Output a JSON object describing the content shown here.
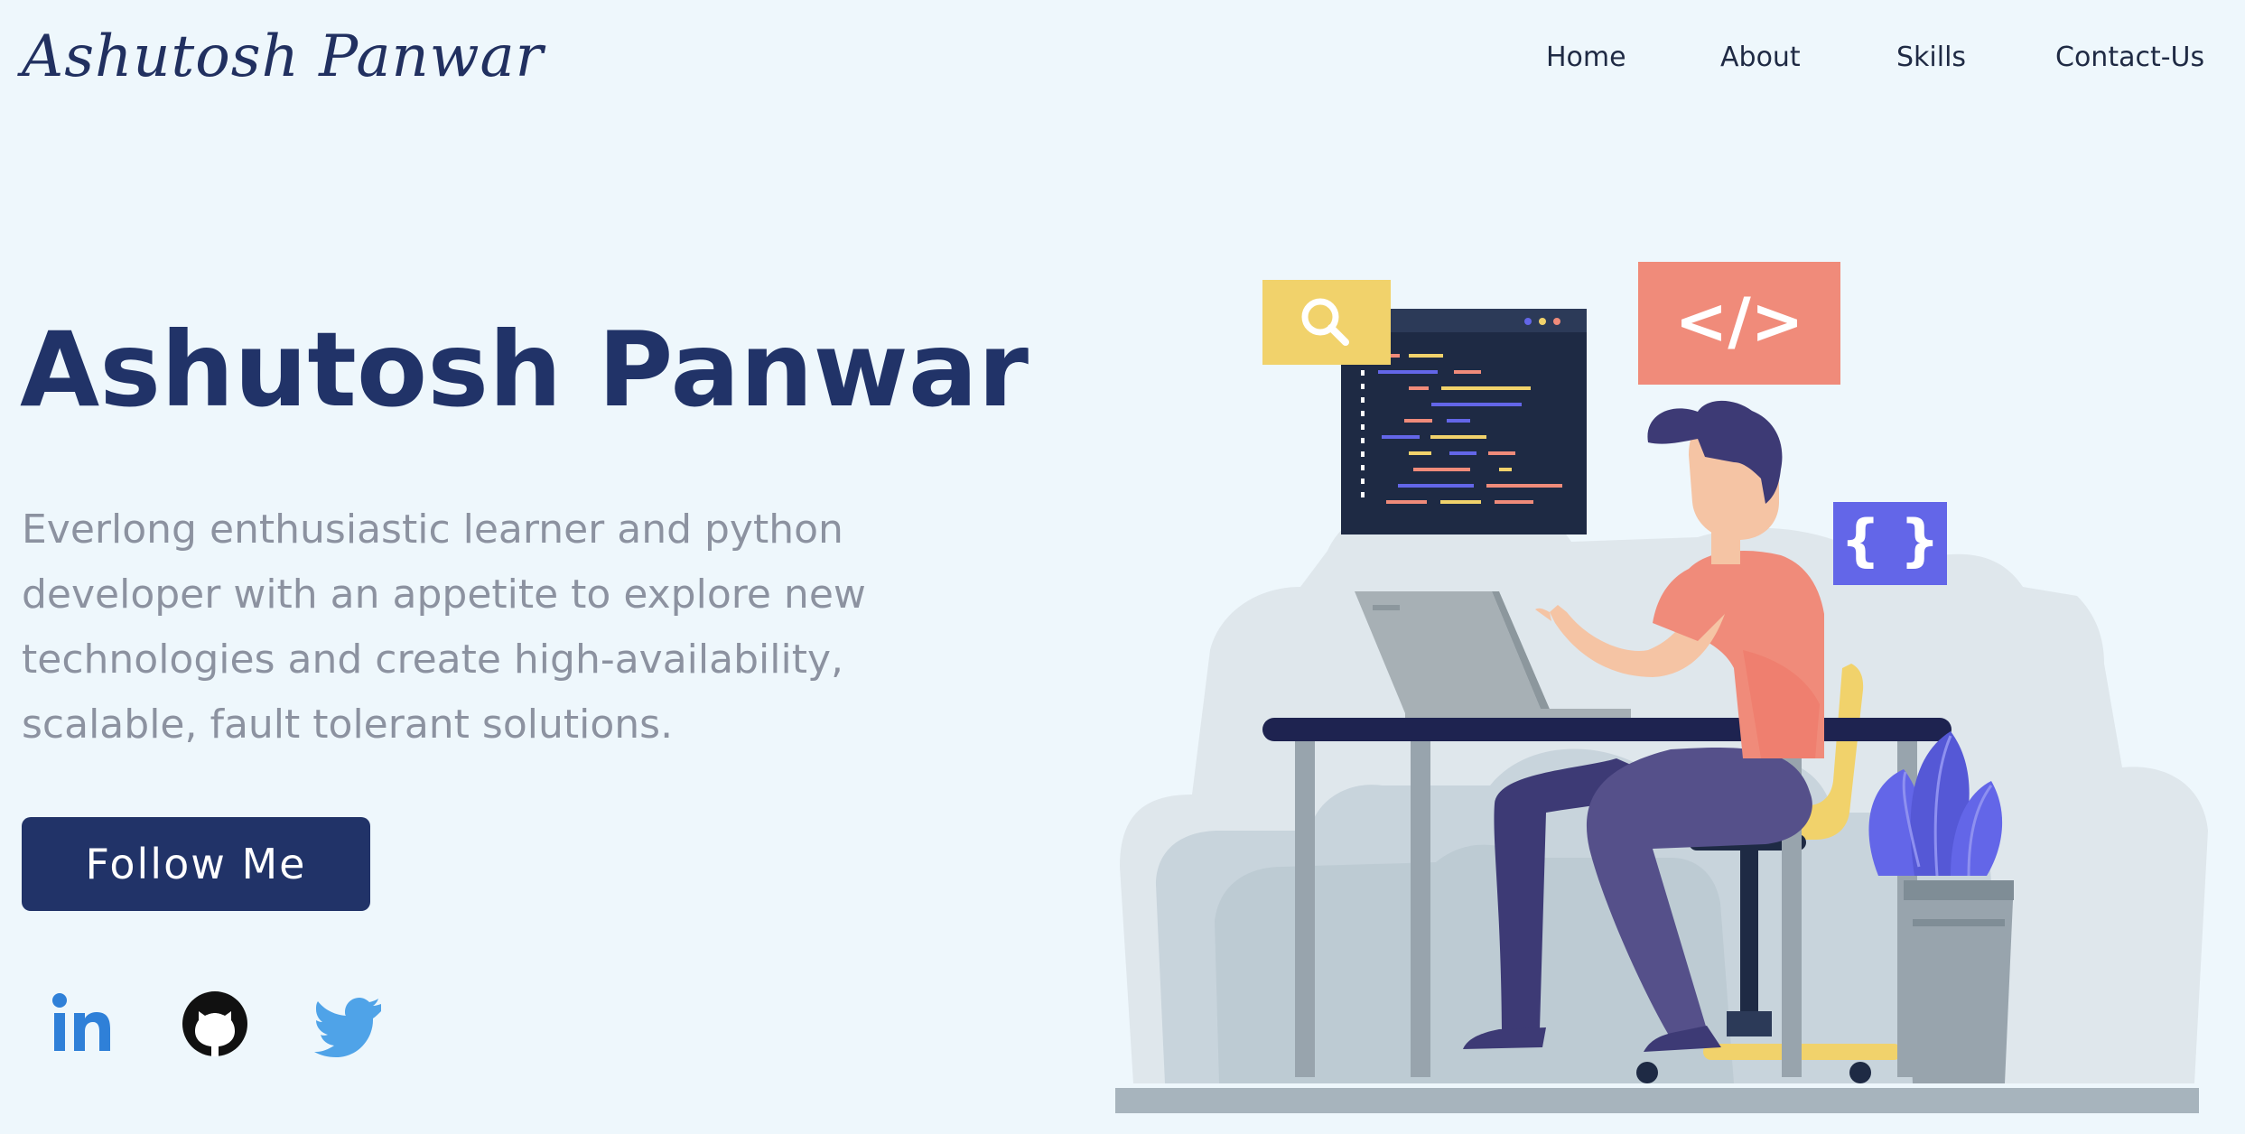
{
  "header": {
    "logo_text": "Ashutosh Panwar",
    "nav": [
      {
        "label": "Home"
      },
      {
        "label": "About"
      },
      {
        "label": "Skills"
      },
      {
        "label": "Contact-Us"
      }
    ]
  },
  "hero": {
    "title": "Ashutosh Panwar",
    "description": "Everlong enthusiastic learner and python developer with an appetite to explore new technologies and create high-availability, scalable, fault tolerant solutions.",
    "follow_button": "Follow Me"
  },
  "social_links": [
    {
      "icon": "linkedin-icon",
      "color": "#2f80d8"
    },
    {
      "icon": "github-icon",
      "color": "#111111"
    },
    {
      "icon": "twitter-icon",
      "color": "#4fa3e8"
    }
  ],
  "illustration": {
    "code_tag_text": "</>",
    "braces_text": "{ }"
  },
  "colors": {
    "background": "#eef7fc",
    "primary": "#213368",
    "muted_text": "#8c92a0",
    "coral": "#f08b7a",
    "yellow": "#f1d26b",
    "violet": "#6366e8"
  }
}
